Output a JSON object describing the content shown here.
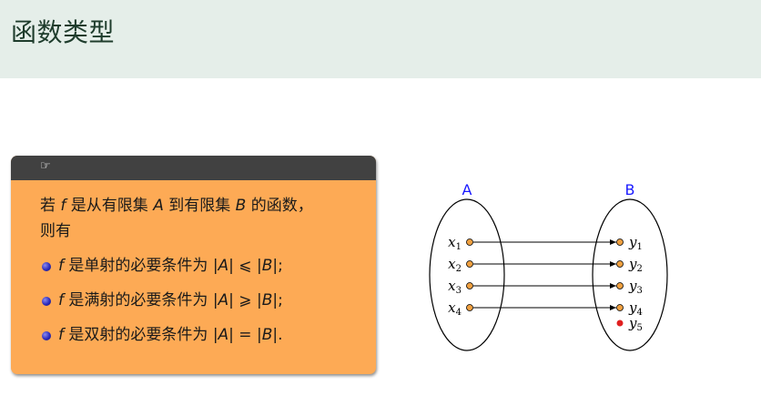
{
  "header": {
    "title": "函数类型"
  },
  "block": {
    "head_icon": "pointing-hand-icon",
    "head_glyph": "☞",
    "intro": {
      "p1": "若 ",
      "f": "f",
      "p2": " 是从有限集 ",
      "A": "A",
      "p3": " 到有限集 ",
      "B": "B",
      "p4": " 的函数，",
      "line2": "则有"
    },
    "items": [
      {
        "f": "f",
        "text": " 是单射的必要条件为 ",
        "formula_A": "|A|",
        "relation": " ⩽ ",
        "formula_B": "|B|",
        "end": ";"
      },
      {
        "f": "f",
        "text": " 是满射的必要条件为 ",
        "formula_A": "|A|",
        "relation": " ⩾ ",
        "formula_B": "|B|",
        "end": ";"
      },
      {
        "f": "f",
        "text": " 是双射的必要条件为 ",
        "formula_A": "|A|",
        "relation": " = ",
        "formula_B": "|B|",
        "end": "."
      }
    ]
  },
  "diagram": {
    "set_a": {
      "label": "A",
      "elements": [
        {
          "base": "x",
          "sub": "1"
        },
        {
          "base": "x",
          "sub": "2"
        },
        {
          "base": "x",
          "sub": "3"
        },
        {
          "base": "x",
          "sub": "4"
        }
      ]
    },
    "set_b": {
      "label": "B",
      "elements": [
        {
          "base": "y",
          "sub": "1"
        },
        {
          "base": "y",
          "sub": "2"
        },
        {
          "base": "y",
          "sub": "3"
        },
        {
          "base": "y",
          "sub": "4"
        },
        {
          "base": "y",
          "sub": "5"
        }
      ]
    },
    "mapping": [
      [
        1,
        1
      ],
      [
        2,
        2
      ],
      [
        3,
        3
      ],
      [
        4,
        4
      ]
    ],
    "colors": {
      "label": "#1a1aff",
      "dot": "#f0a040",
      "unmapped_dot": "#e02020",
      "line": "#000000"
    }
  }
}
